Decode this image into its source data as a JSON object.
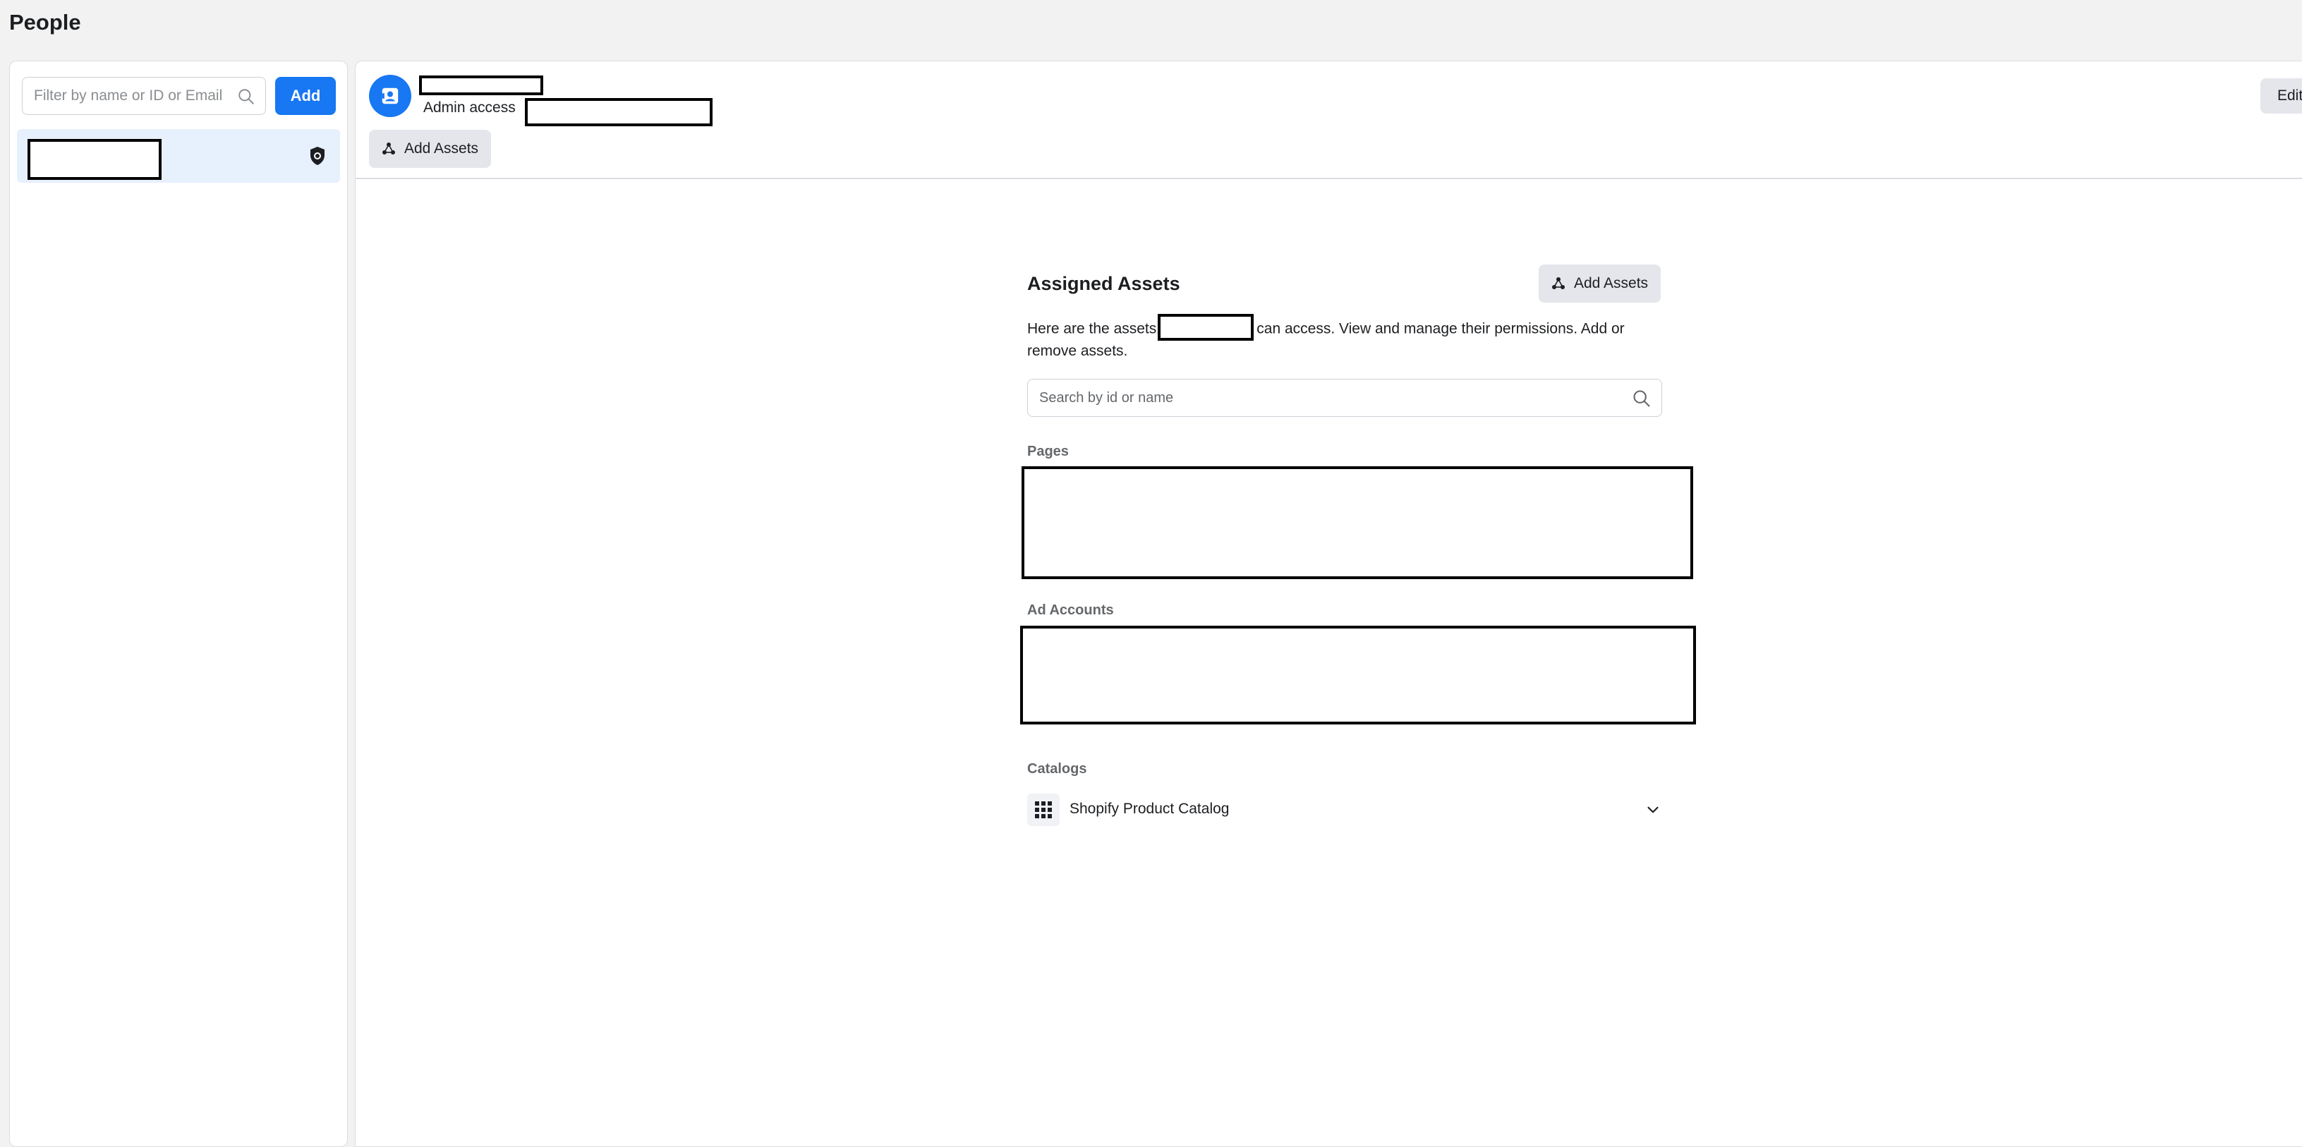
{
  "page": {
    "title": "People"
  },
  "left_panel": {
    "filter_placeholder": "Filter by name or ID or Email",
    "add_label": "Add"
  },
  "header": {
    "role_text": "Admin access",
    "add_assets_label": "Add Assets",
    "edit_label": "Edit"
  },
  "assigned_assets": {
    "title": "Assigned Assets",
    "add_assets_label": "Add Assets",
    "description_before": "Here are the assets",
    "description_after": "can access. View and manage their permissions. Add or remove assets.",
    "search_placeholder": "Search by id or name",
    "groups": {
      "pages": "Pages",
      "ad_accounts": "Ad Accounts",
      "catalogs": "Catalogs"
    },
    "catalog_items": [
      {
        "name": "Shopify Product Catalog"
      }
    ]
  },
  "colors": {
    "accent": "#1877f2",
    "selected_row": "#e7f0fd",
    "button_grey": "#e4e6eb",
    "page_bg": "#f2f2f2"
  },
  "icons": {
    "search": "search-icon",
    "shield": "shield-icon",
    "assets": "assets-icon",
    "avatar": "person-badge-icon",
    "catalog": "grid-icon",
    "chevron": "chevron-down-icon"
  }
}
